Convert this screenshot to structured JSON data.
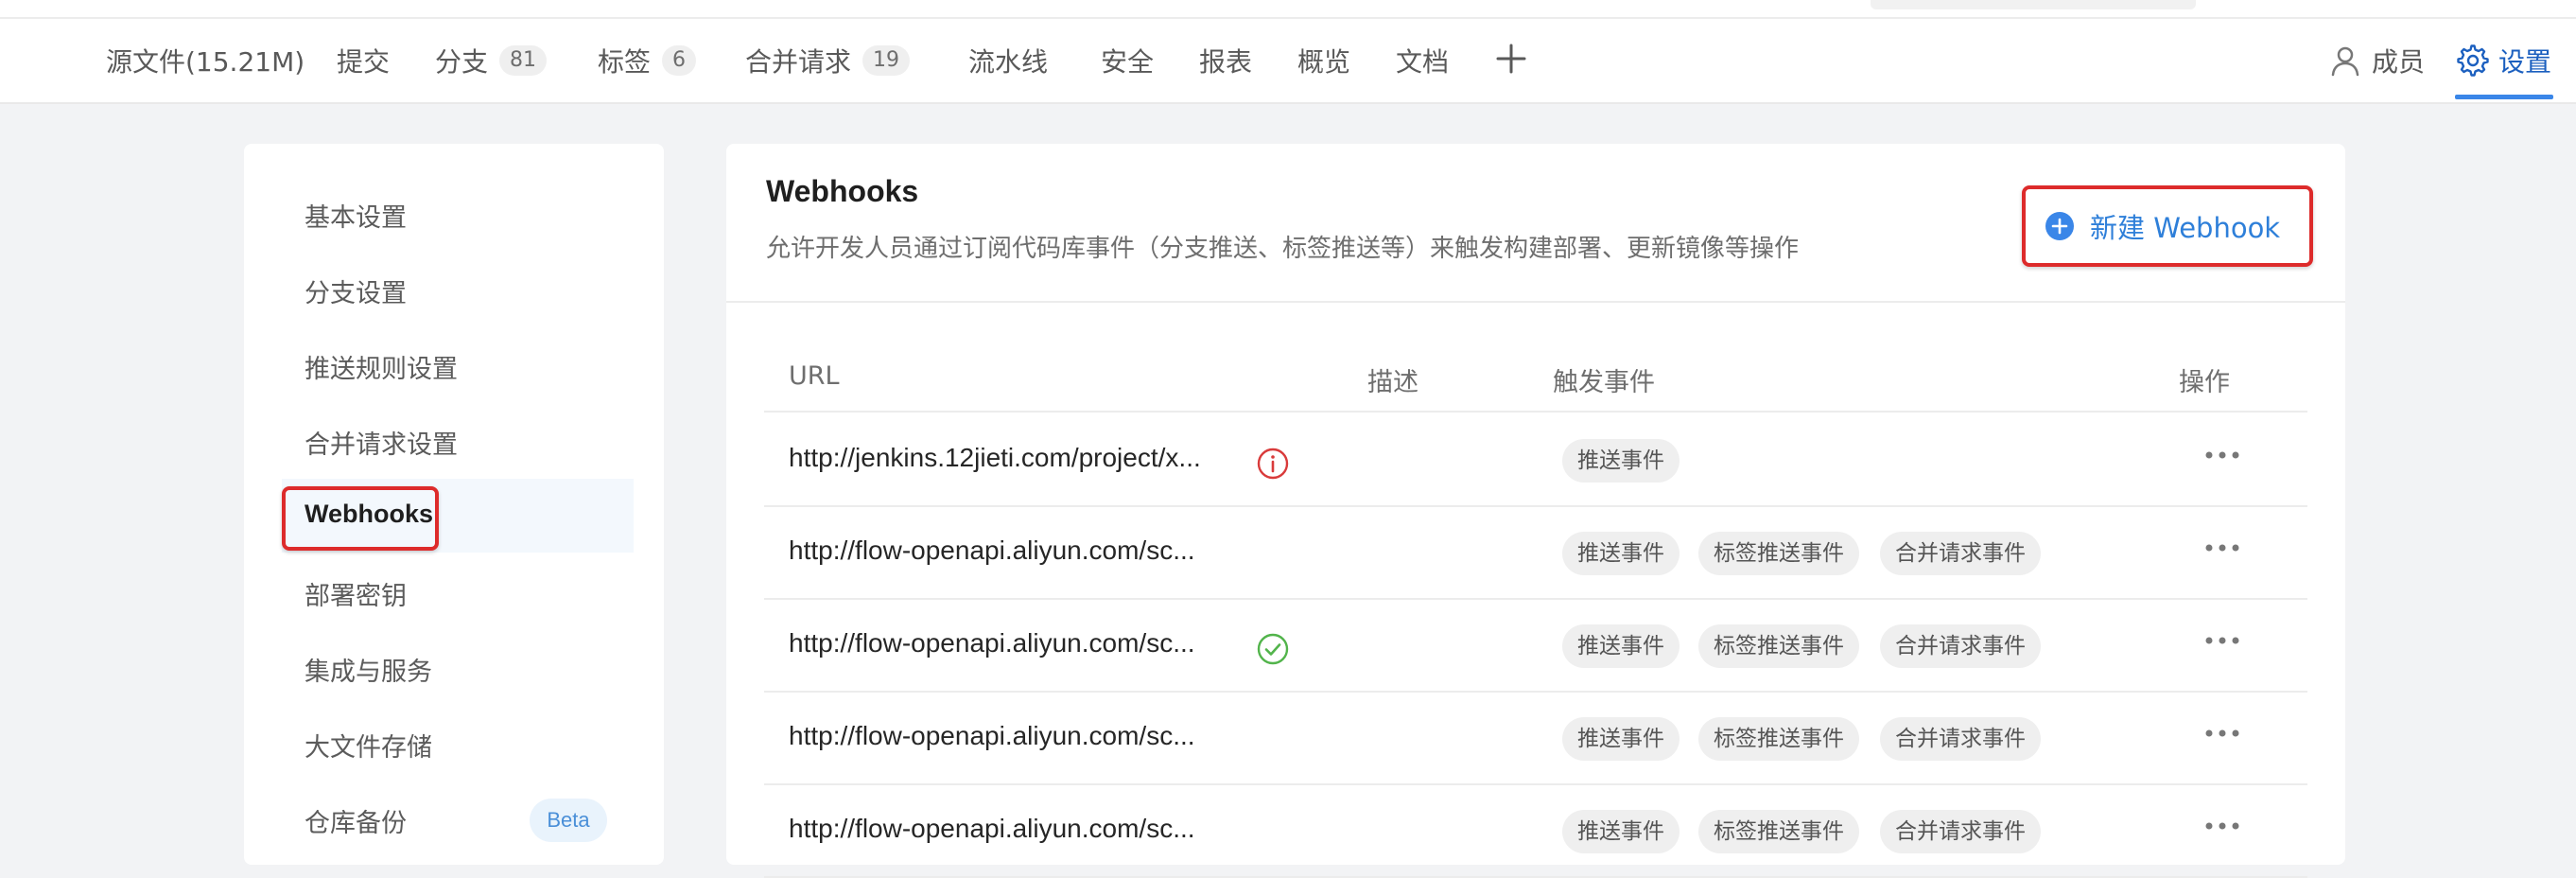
{
  "nav": {
    "items": [
      {
        "label": "源文件(15.21M)",
        "badge": null
      },
      {
        "label": "提交",
        "badge": null
      },
      {
        "label": "分支",
        "badge": "81"
      },
      {
        "label": "标签",
        "badge": "6"
      },
      {
        "label": "合并请求",
        "badge": "19"
      },
      {
        "label": "流水线",
        "badge": null
      },
      {
        "label": "安全",
        "badge": null
      },
      {
        "label": "报表",
        "badge": null
      },
      {
        "label": "概览",
        "badge": null
      },
      {
        "label": "文档",
        "badge": null
      }
    ],
    "add_icon": "plus-icon",
    "members_label": "成员",
    "settings_label": "设置",
    "active_item": "设置"
  },
  "sidebar": {
    "items": [
      {
        "label": "基本设置"
      },
      {
        "label": "分支设置"
      },
      {
        "label": "推送规则设置"
      },
      {
        "label": "合并请求设置"
      },
      {
        "label": "Webhooks",
        "active": true
      },
      {
        "label": "部署密钥"
      },
      {
        "label": "集成与服务"
      },
      {
        "label": "大文件存储"
      },
      {
        "label": "仓库备份",
        "badge": "Beta"
      }
    ]
  },
  "main": {
    "title": "Webhooks",
    "description": "允许开发人员通过订阅代码库事件（分支推送、标签推送等）来触发构建部署、更新镜像等操作",
    "new_button_label": "新建 Webhook",
    "table": {
      "columns": [
        "URL",
        "描述",
        "触发事件",
        "操作"
      ],
      "rows": [
        {
          "url": "http://jenkins.12jieti.com/project/x...",
          "status": "error",
          "events": [
            "推送事件"
          ]
        },
        {
          "url": "http://flow-openapi.aliyun.com/sc...",
          "status": "none",
          "events": [
            "推送事件",
            "标签推送事件",
            "合并请求事件"
          ]
        },
        {
          "url": "http://flow-openapi.aliyun.com/sc...",
          "status": "success",
          "events": [
            "推送事件",
            "标签推送事件",
            "合并请求事件"
          ]
        },
        {
          "url": "http://flow-openapi.aliyun.com/sc...",
          "status": "none",
          "events": [
            "推送事件",
            "标签推送事件",
            "合并请求事件"
          ]
        },
        {
          "url": "http://flow-openapi.aliyun.com/sc...",
          "status": "none",
          "events": [
            "推送事件",
            "标签推送事件",
            "合并请求事件"
          ]
        }
      ]
    }
  },
  "colors": {
    "accent": "#2e7fd9",
    "highlight": "#dd2b2b",
    "error": "#d93b3b",
    "success": "#52b44b"
  }
}
